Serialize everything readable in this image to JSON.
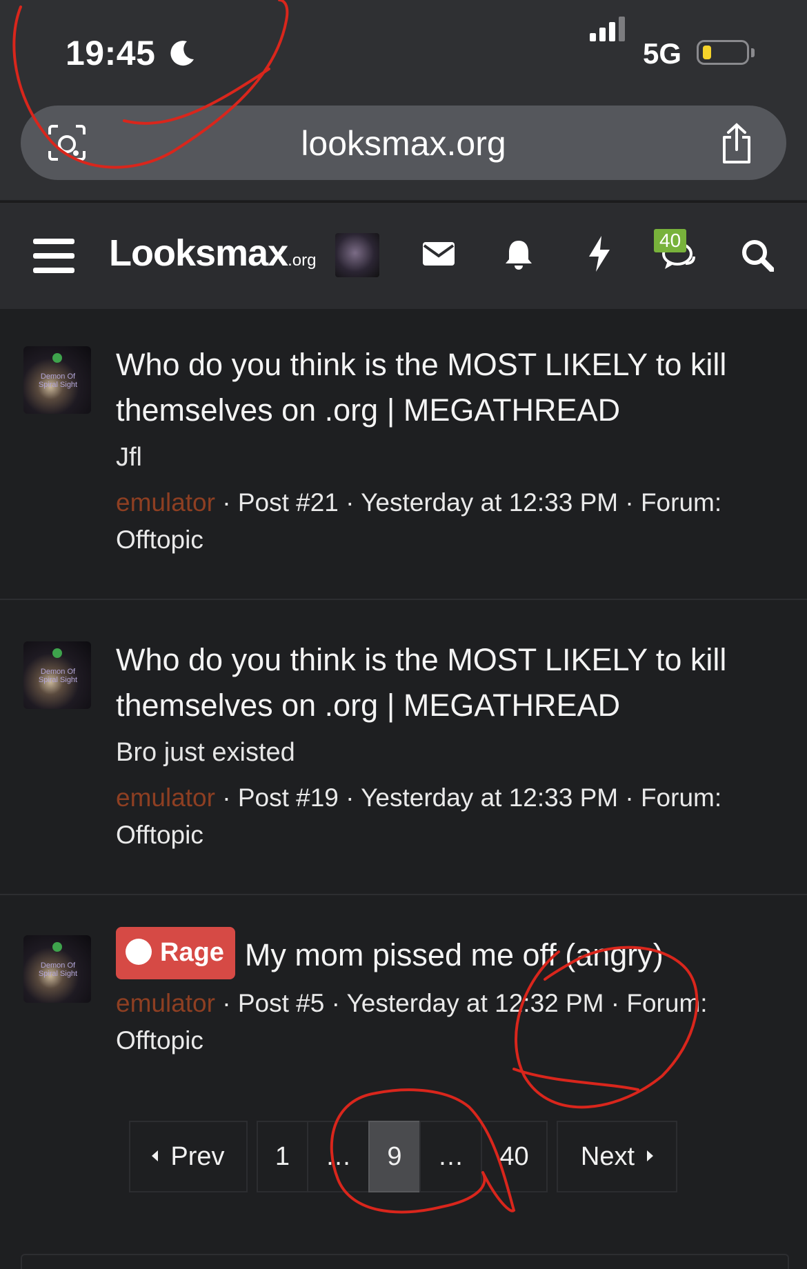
{
  "status_bar": {
    "time": "19:45",
    "network": "5G"
  },
  "browser": {
    "url": "looksmax.org"
  },
  "site_header": {
    "logo_main": "Looksmax",
    "logo_suffix": ".org",
    "chat_badge": "40"
  },
  "results": [
    {
      "title": "Who do you think is the MOST LIKELY to kill themselves on .org | MEGATHREAD",
      "snippet": "Jfl",
      "author": "emulator",
      "meta": " · Post #21 · Yesterday at 12:33 PM · Forum: Offtopic"
    },
    {
      "title": "Who do you think is the MOST LIKELY to kill themselves on .org | MEGATHREAD",
      "snippet": "Bro just existed",
      "author": "emulator",
      "meta": " · Post #19 · Yesterday at 12:33 PM · Forum: Offtopic"
    },
    {
      "prefix": "Rage",
      "title": "My mom pissed me off (angry)",
      "author": "emulator",
      "meta": " · Post #5 · Yesterday at 12:32 PM · Forum: Offtopic"
    }
  ],
  "avatar_caption": "Demon Of Spiral Sight",
  "pagination": {
    "prev_label": "Prev",
    "pages": [
      "1",
      "…",
      "9",
      "…",
      "40"
    ],
    "current": "9",
    "next_label": "Next"
  },
  "colors": {
    "annotation": "#d9261c",
    "author": "#8e3f22",
    "rage_tag": "#d64a45",
    "badge": "#78b23b"
  }
}
